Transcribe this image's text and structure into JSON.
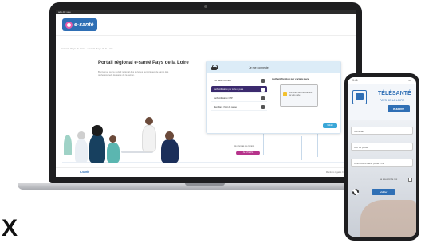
{
  "laptop": {
    "browser_bar": "ads dic sale",
    "logo_text": "e-santé",
    "breadcrumb": "Accueil · Pays de Loire · e-santé Pays de la Loire",
    "portal_title": "Portail régional e-santé Pays de la Loire",
    "portal_description": "Bienvenue sur le portail national des services numériques de santé des professionnels de santé de la région.",
    "login": {
      "heading": "Je me connecte",
      "methods": [
        {
          "label": "Pro Santé Connect",
          "active": false
        },
        {
          "label": "Authentification par carte à puce",
          "active": true
        },
        {
          "label": "Authentification OTP",
          "active": false
        },
        {
          "label": "Identifiant / Mot de passe",
          "active": false
        }
      ],
      "detail_title": "Authentification par carte à puce",
      "detail_message": "Connectez-vous directement via votre carte",
      "validate_label": "Valider"
    },
    "qr_label": "Je n'ai pas de compte",
    "qr_button": "Je m'inscris",
    "footer_logo": "e-santé",
    "footer_links": "Mentions légales   Contact"
  },
  "phone": {
    "time": "9:41",
    "signal": "•••",
    "brand": "TÉLÉSANTÉ",
    "region": "PAYS DE LA LOIRE",
    "logo": "e-santé",
    "fields": [
      "Identifiant",
      "Mot de passe",
      "Chiffrement carte (code PIN)"
    ],
    "remember_label": "Se souvenir de moi",
    "submit_label": "Valider"
  },
  "close_symbol": "X",
  "colors": {
    "brand_blue": "#2f6fb5",
    "active_method": "#3b2a6e",
    "accent_pink": "#b6338b",
    "panel_header": "#dcecf7"
  },
  "icons": {
    "lock": "lock-icon",
    "settings": "gear-icon",
    "close": "close-icon"
  }
}
